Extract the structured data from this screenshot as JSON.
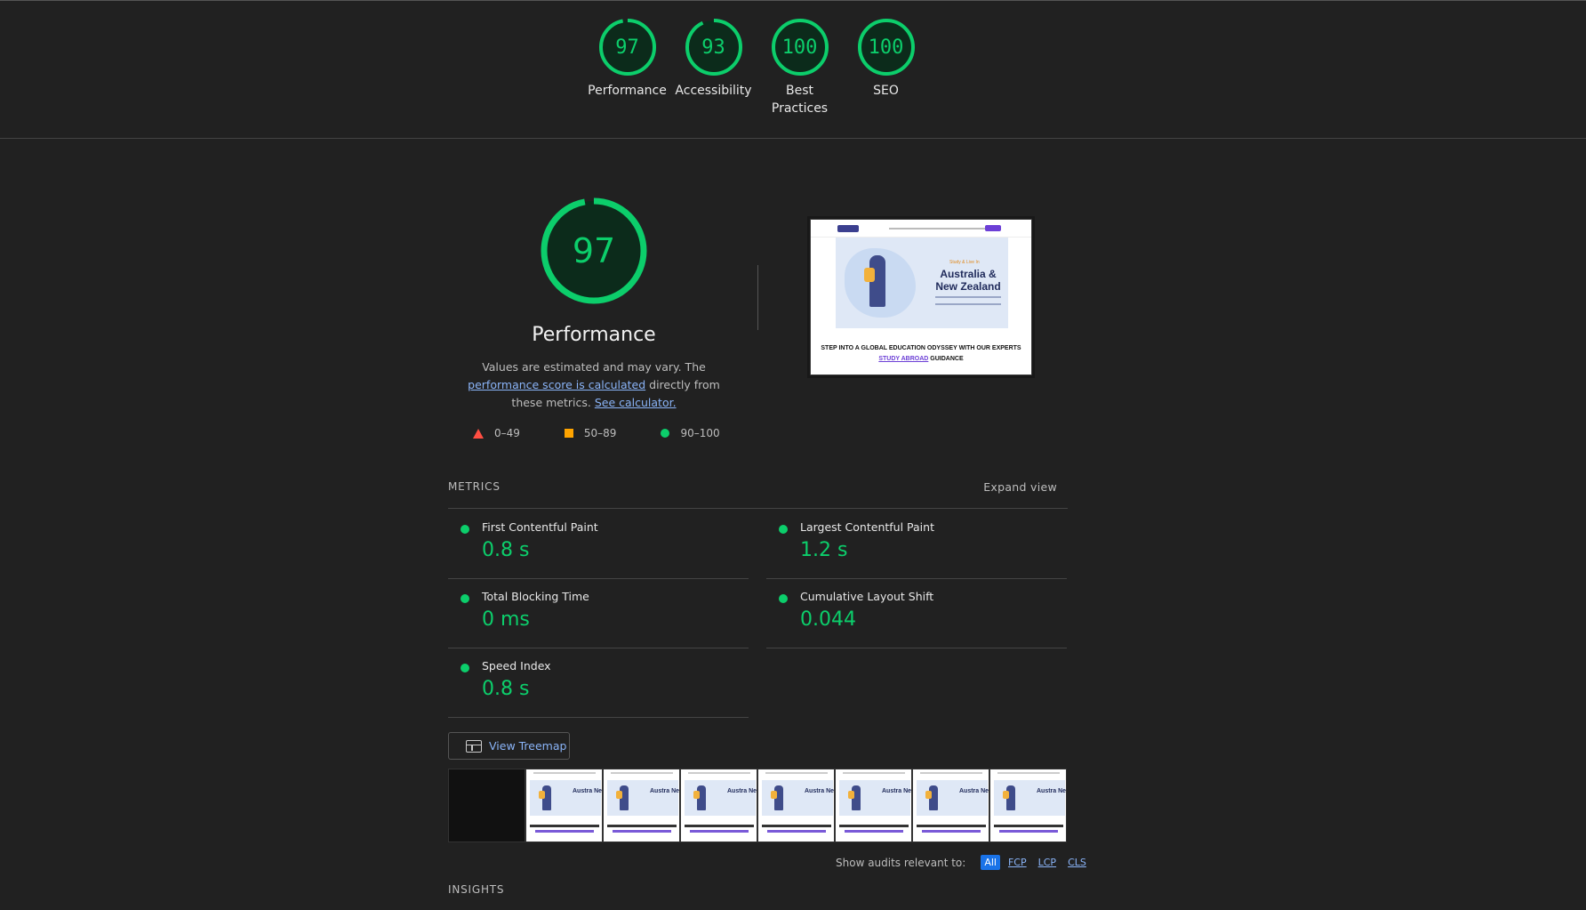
{
  "summary": {
    "gauges": [
      {
        "score": "97",
        "label": "Performance"
      },
      {
        "score": "93",
        "label": "Accessibility"
      },
      {
        "score": "100",
        "label": "Best Practices"
      },
      {
        "score": "100",
        "label": "SEO"
      }
    ]
  },
  "performance": {
    "score": "97",
    "title": "Performance",
    "desc_pre": "Values are estimated and may vary. The ",
    "desc_link1": "performance score is calculated",
    "desc_mid": " directly from these metrics. ",
    "desc_link2": "See calculator.",
    "legend": [
      {
        "range": "0–49",
        "icon": "triangle-icon",
        "color": "#ff4e42"
      },
      {
        "range": "50–89",
        "icon": "square-icon",
        "color": "#ffa400"
      },
      {
        "range": "90–100",
        "icon": "circle-icon",
        "color": "#0cce6b"
      }
    ]
  },
  "screenshot": {
    "study_label": "Study & Live In",
    "headline": "Australia & New Zealand",
    "footer_pre": "STEP INTO A GLOBAL EDUCATION ODYSSEY WITH OUR EXPERTS ",
    "footer_link": "STUDY ABROAD",
    "footer_post": " GUIDANCE"
  },
  "metrics": {
    "heading": "METRICS",
    "expand": "Expand view",
    "items": [
      {
        "title": "First Contentful Paint",
        "value": "0.8 s"
      },
      {
        "title": "Largest Contentful Paint",
        "value": "1.2 s"
      },
      {
        "title": "Total Blocking Time",
        "value": "0 ms"
      },
      {
        "title": "Cumulative Layout Shift",
        "value": "0.044"
      },
      {
        "title": "Speed Index",
        "value": "0.8 s"
      }
    ]
  },
  "treemap": {
    "label": "View Treemap"
  },
  "filmstrip": {
    "frame_text": "Austra New Zeal"
  },
  "audits": {
    "label": "Show audits relevant to:",
    "filters": [
      "All",
      "FCP",
      "LCP",
      "CLS"
    ]
  },
  "insights": {
    "heading": "INSIGHTS"
  },
  "colors": {
    "pass": "#0cce6b",
    "average": "#ffa400",
    "fail": "#ff4e42",
    "link": "#8ab4f8",
    "accent": "#1a73e8"
  }
}
